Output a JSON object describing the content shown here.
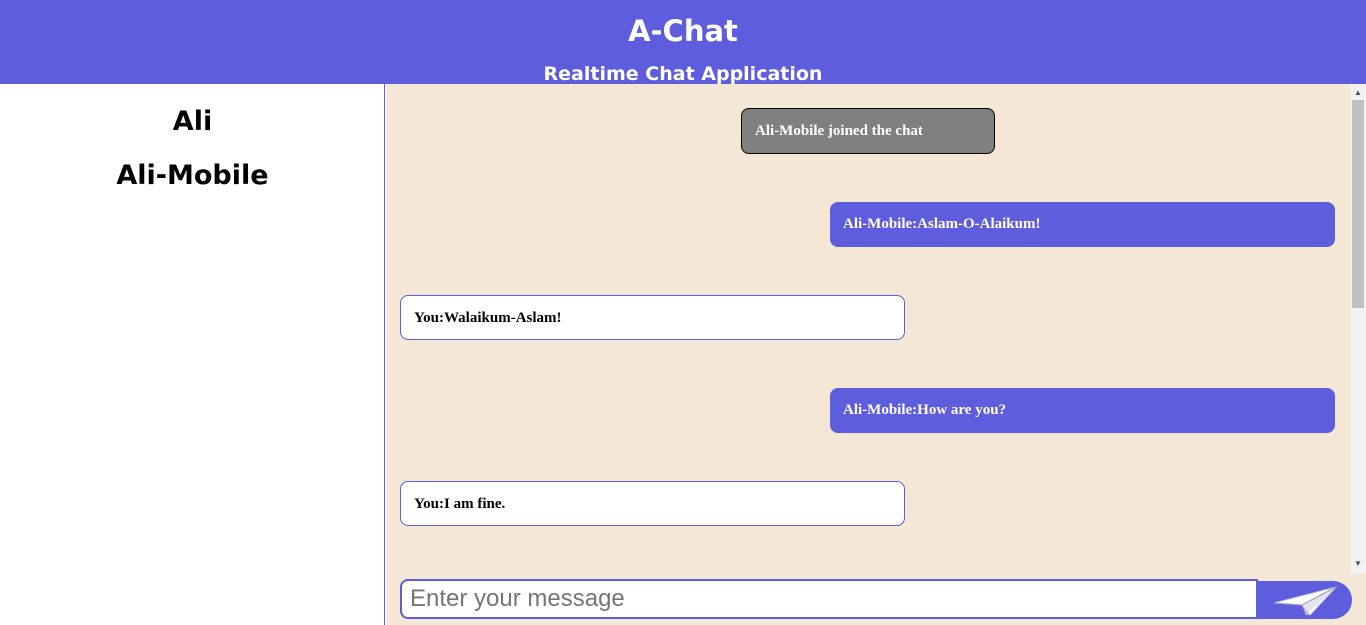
{
  "header": {
    "title": "A-Chat",
    "subtitle": "Realtime Chat Application"
  },
  "sidebar": {
    "users": [
      "Ali",
      "Ali-Mobile"
    ]
  },
  "messages": [
    {
      "type": "system",
      "text": "Ali-Mobile joined the chat"
    },
    {
      "type": "incoming",
      "text": "Ali-Mobile:Aslam-O-Alaikum!"
    },
    {
      "type": "outgoing",
      "text": "You:Walaikum-Aslam!"
    },
    {
      "type": "incoming",
      "text": "Ali-Mobile:How are you?"
    },
    {
      "type": "outgoing",
      "text": "You:I am fine."
    }
  ],
  "composer": {
    "placeholder": "Enter your message",
    "send_icon": "paper-plane-icon"
  },
  "colors": {
    "accent": "#5d5ddd",
    "chat_background": "#f5e7d6",
    "system_message": "#808080"
  }
}
